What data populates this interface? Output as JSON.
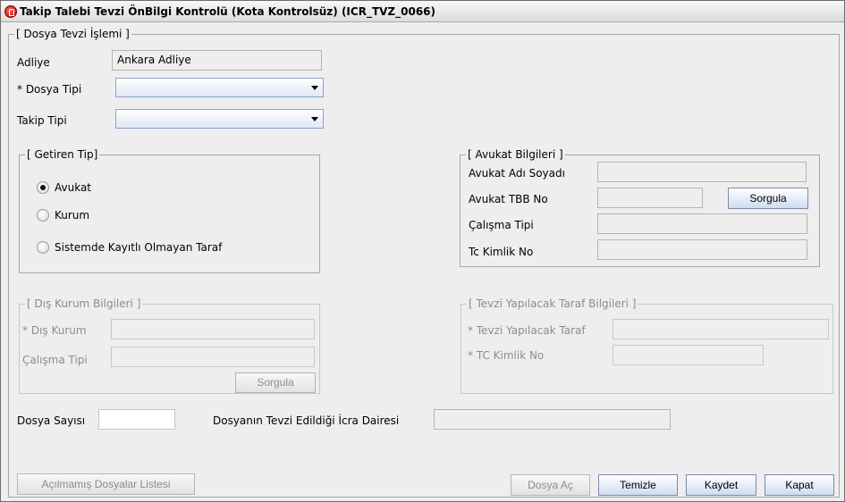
{
  "window": {
    "title": "Takip Talebi Tevzi ÖnBilgi Kontrolü (Kota Kontrolsüz) (ICR_TVZ_0066)"
  },
  "main_group": {
    "legend": "[ Dosya Tevzi İşlemi ]",
    "adliye_label": "Adliye",
    "adliye_value": "Ankara Adliye",
    "dosya_tipi_label": "* Dosya Tipi",
    "dosya_tipi_value": "",
    "takip_tipi_label": "Takip Tipi",
    "takip_tipi_value": ""
  },
  "getiren_tip": {
    "legend": "[ Getiren Tip]",
    "options": [
      "Avukat",
      "Kurum",
      "Sistemde Kayıtlı Olmayan Taraf"
    ],
    "selected": "Avukat"
  },
  "avukat_bilgileri": {
    "legend": "[ Avukat Bilgileri ]",
    "adi_soyadi_label": "Avukat Adı Soyadı",
    "adi_soyadi_value": "",
    "tbb_no_label": "Avukat TBB No",
    "tbb_no_value": "",
    "sorgula_label": "Sorgula",
    "calisma_tipi_label": "Çalışma Tipi",
    "calisma_tipi_value": "",
    "tc_kimlik_label": "Tc Kimlik No",
    "tc_kimlik_value": ""
  },
  "dis_kurum_bilgileri": {
    "legend": "[ Dış Kurum Bilgileri ]",
    "dis_kurum_label": "* Dış Kurum",
    "dis_kurum_value": "",
    "calisma_tipi_label": "Çalışma Tipi",
    "calisma_tipi_value": "",
    "sorgula_label": "Sorgula"
  },
  "tevzi_taraf_bilgileri": {
    "legend": "[ Tevzi Yapılacak Taraf Bilgileri ]",
    "taraf_label": "* Tevzi Yapılacak Taraf",
    "taraf_value": "",
    "tc_kimlik_label": "* TC Kimlik No",
    "tc_kimlik_value": ""
  },
  "bottom": {
    "dosya_sayisi_label": "Dosya Sayısı",
    "dosya_sayisi_value": "",
    "icra_dairesi_label": "Dosyanın Tevzi Edildiği İcra Dairesi",
    "icra_dairesi_value": ""
  },
  "buttons": {
    "acilmamis": "Açılmamış Dosyalar Listesi",
    "dosya_ac": "Dosya Aç",
    "temizle": "Temizle",
    "kaydet": "Kaydet",
    "kapat": "Kapat"
  }
}
